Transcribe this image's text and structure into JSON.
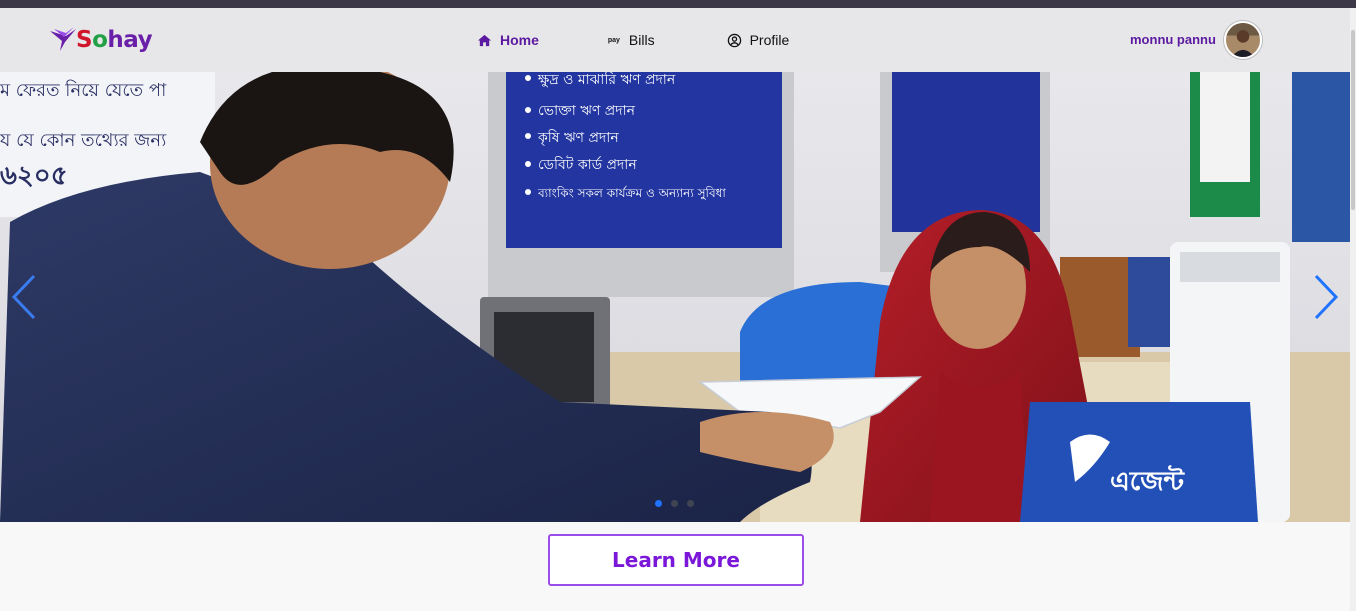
{
  "brand": {
    "name_s": "S",
    "name_o": "o",
    "name_rest": "hay",
    "colors": {
      "s": "#d1162b",
      "o": "#23a045",
      "rest": "#6a1fa8"
    }
  },
  "nav": {
    "items": [
      {
        "label": "Home",
        "icon": "home-icon",
        "active": true
      },
      {
        "label": "Bills",
        "icon": "pay-icon",
        "active": false
      },
      {
        "label": "Profile",
        "icon": "user-circle-icon",
        "active": false
      }
    ],
    "pay_glyph": "pay"
  },
  "user": {
    "name": "monnu pannu"
  },
  "carousel": {
    "slide_count": 3,
    "active_slide": 1,
    "bengali_text": {
      "left_line1": "ম ফেরত নিয়ে যেতে পা",
      "left_line2": "য যে কোন তথ্যের জন্য",
      "left_line3": "৬২০৫",
      "board_items": [
        "ক্ষুদ্র ও মাঝারি ঋণ প্রদান",
        "ভোক্তা ঋণ প্রদান",
        "কৃষি ঋণ প্রদান",
        "ডেবিট কার্ড প্রদান",
        "ব্যাংকিং সকল কার্যক্রম ও অন্যান্য সুবিধা"
      ],
      "desk_sign": "এজেন্ট"
    }
  },
  "cta": {
    "label": "Learn More"
  },
  "colors": {
    "accent": "#5b1aa0",
    "cta": "#7a17d9",
    "dot_active": "#1f73ff",
    "nav_bg": "#e7e7ea"
  }
}
